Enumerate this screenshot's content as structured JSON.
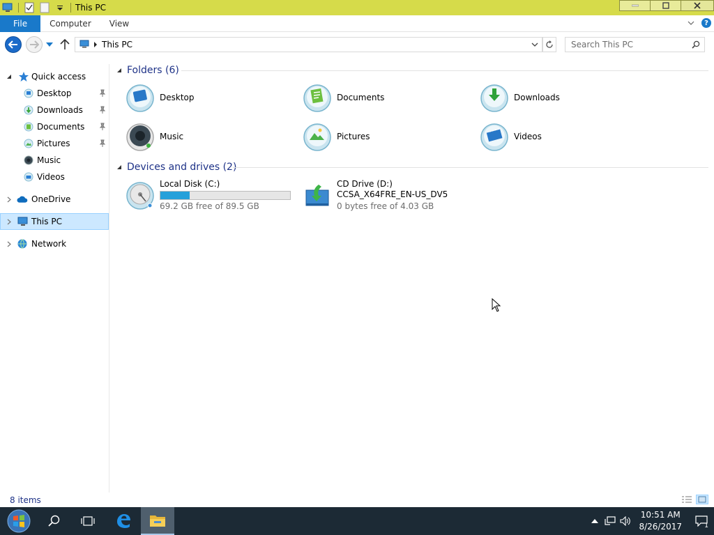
{
  "window": {
    "title": "This PC"
  },
  "ribbon": {
    "tabs": [
      {
        "label": "File"
      },
      {
        "label": "Computer"
      },
      {
        "label": "View"
      }
    ],
    "help_label": "?"
  },
  "address": {
    "path": "This PC",
    "search_placeholder": "Search This PC"
  },
  "nav_pane": {
    "quick_access": "Quick access",
    "pinned": [
      {
        "label": "Desktop",
        "pinned": true
      },
      {
        "label": "Downloads",
        "pinned": true
      },
      {
        "label": "Documents",
        "pinned": true
      },
      {
        "label": "Pictures",
        "pinned": true
      },
      {
        "label": "Music",
        "pinned": false
      },
      {
        "label": "Videos",
        "pinned": false
      }
    ],
    "onedrive": "OneDrive",
    "this_pc": "This PC",
    "network": "Network"
  },
  "folders": {
    "title": "Folders (6)",
    "items": [
      {
        "label": "Desktop"
      },
      {
        "label": "Documents"
      },
      {
        "label": "Downloads"
      },
      {
        "label": "Music"
      },
      {
        "label": "Pictures"
      },
      {
        "label": "Videos"
      }
    ]
  },
  "drives": {
    "title": "Devices and drives (2)",
    "items": [
      {
        "name": "Local Disk (C:)",
        "sub": "",
        "free": "69.2 GB free of 89.5 GB",
        "used_fraction": 0.227
      },
      {
        "name": "CD Drive (D:)",
        "sub": "CCSA_X64FRE_EN-US_DV5",
        "free": "0 bytes free of 4.03 GB"
      }
    ]
  },
  "status": {
    "items": "8 items"
  },
  "taskbar": {
    "time": "10:51 AM",
    "date": "8/26/2017",
    "notifications": "1"
  },
  "colors": {
    "title_bar": "#d6db4a",
    "accent": "#1979ca",
    "taskbar": "#1c2a35",
    "selection": "#cce8ff"
  }
}
